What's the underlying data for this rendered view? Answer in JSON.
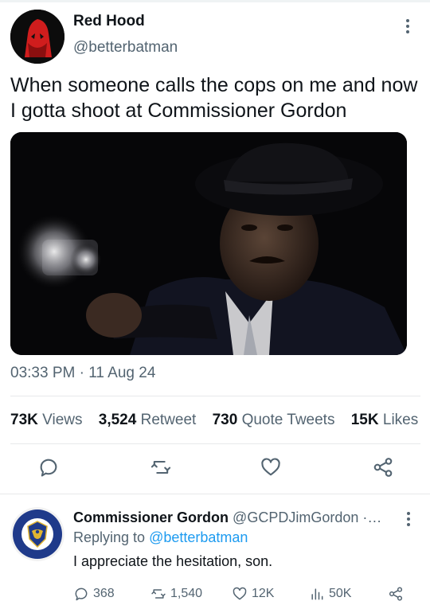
{
  "tweet": {
    "author_name": "Red Hood",
    "author_handle": "@betterbatman",
    "text": "When someone calls the cops on me and now I gotta shoot at Commissioner Gordon",
    "time": "03:33 PM",
    "date": "11 Aug 24",
    "stats": {
      "views_count": "73K",
      "views_label": "Views",
      "retweets_count": "3,524",
      "retweets_label": "Retweet",
      "quotes_count": "730",
      "quotes_label": "Quote Tweets",
      "likes_count": "15K",
      "likes_label": "Likes"
    },
    "actions": [
      "reply-icon",
      "retweet-icon",
      "like-icon",
      "share-icon"
    ]
  },
  "reply": {
    "author_name": "Commissioner Gordon",
    "author_handle": "@GCPDJimGordon",
    "ellipsis": "·…",
    "replying_prefix": "Replying to",
    "replying_to": "@betterbatman",
    "text": "I appreciate the hesitation, son.",
    "replies": "368",
    "retweets": "1,540",
    "likes": "12K",
    "views": "50K"
  },
  "colors": {
    "text": "#0f1419",
    "secondary": "#536471",
    "link": "#1d9bf0",
    "badge_blue": "#1f3a8a",
    "badge_gold": "#e0b431"
  }
}
